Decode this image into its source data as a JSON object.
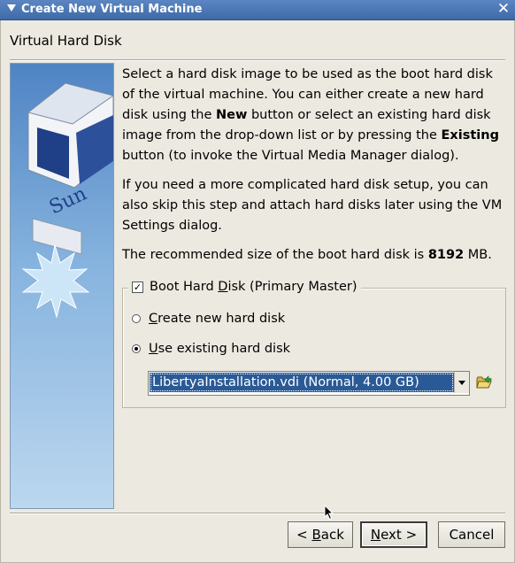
{
  "window": {
    "title": "Create New Virtual Machine",
    "close_glyph": "✕"
  },
  "page": {
    "heading": "Virtual Hard Disk"
  },
  "description": {
    "p1_parts": [
      "Select a hard disk image to be used as the boot hard disk of the virtual machine. You can either create a new hard disk using the ",
      "New",
      " button or select an existing hard disk image from the drop-down list or by pressing the ",
      "Existing",
      " button (to invoke the Virtual Media Manager dialog)."
    ],
    "p2": "If you need a more complicated hard disk setup, you can also skip this step and attach hard disks later using the VM Settings dialog.",
    "p3_prefix": "The recommended size of the boot hard disk is ",
    "p3_value": "8192",
    "p3_suffix": " MB."
  },
  "boot_disk": {
    "checkbox_label_pre": "Boot Hard ",
    "checkbox_label_u": "D",
    "checkbox_label_post": "isk (Primary Master)",
    "checked": true,
    "checkmark": "✓",
    "option_new_u": "C",
    "option_new_rest": "reate new hard disk",
    "option_existing_u": "U",
    "option_existing_rest": "se existing hard disk",
    "selected_option": "existing",
    "selected_image": "LibertyaInstallation.vdi (Normal, 4.00 GB)"
  },
  "buttons": {
    "back_pre": "< ",
    "back_u": "B",
    "back_post": "ack",
    "next_u": "N",
    "next_post": "ext >",
    "cancel": "Cancel"
  },
  "colors": {
    "title_bar": "#3e6aa8",
    "selection": "#2a5a96",
    "dialog_bg": "#ece9e0"
  },
  "icons": {
    "app": "triangle-icon",
    "close": "close-icon",
    "folder": "open-folder-icon",
    "side_art": "virtualbox-logo",
    "cursor": "mouse-pointer-icon"
  }
}
